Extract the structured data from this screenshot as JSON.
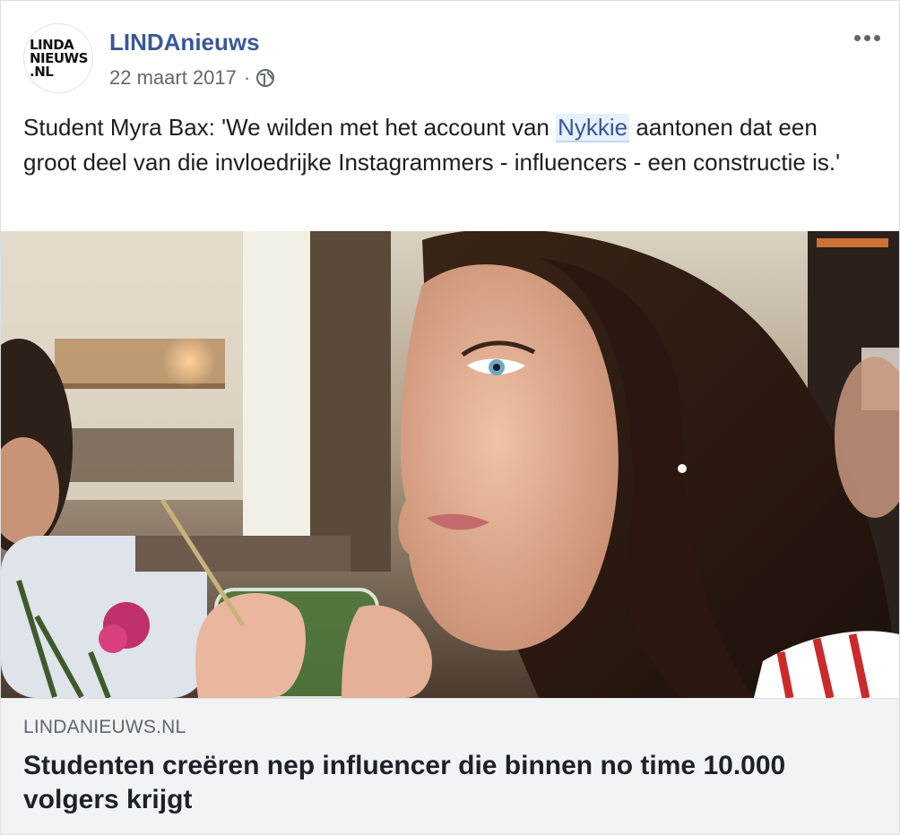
{
  "post": {
    "page_name": "LINDAnieuws",
    "avatar_text": "LINDA\nNIEUWS\n.NL",
    "date": "22 maart 2017",
    "separator": "·",
    "privacy_icon": "globe-icon",
    "more_icon": "more-dots-icon",
    "text_before": "Student Myra Bax: 'We wilden met het account van ",
    "mention": "Nykkie",
    "text_after": " aantonen dat een groot deel van die invloedrijke Instagrammers - influencers - een constructie is.'"
  },
  "link_preview": {
    "domain": "LINDANIEUWS.NL",
    "headline": "Studenten creëren nep influencer die binnen no time 10.000 volgers krijgt"
  },
  "colors": {
    "page_name": "#385898",
    "mention_bg": "#e7f0fd",
    "preview_bg": "#f2f3f5",
    "meta_text": "#616770"
  }
}
